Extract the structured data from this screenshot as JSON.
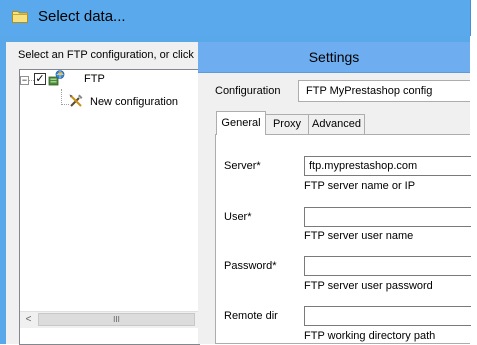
{
  "window": {
    "title": "Select data..."
  },
  "left": {
    "instruction": "Select an FTP configuration, or click",
    "tree": {
      "expander": "−",
      "checkbox": "✓",
      "root_label": "FTP",
      "child_label": "New configuration"
    },
    "scrollbar": {
      "left_arrow": "<",
      "thumb_grip": "III"
    }
  },
  "settings": {
    "header": "Settings",
    "config_label": "Configuration",
    "config_value": "FTP MyPrestashop config",
    "tabs": [
      {
        "label": "General"
      },
      {
        "label": "Proxy"
      },
      {
        "label": "Advanced"
      }
    ],
    "fields": [
      {
        "label": "Server*",
        "value": "ftp.myprestashop.com",
        "help": "FTP server name or IP"
      },
      {
        "label": "User*",
        "value": "",
        "help": "FTP server user name"
      },
      {
        "label": "Password*",
        "value": "",
        "help": "FTP server user password"
      },
      {
        "label": "Remote dir",
        "value": "",
        "help": "FTP working directory path"
      }
    ]
  }
}
